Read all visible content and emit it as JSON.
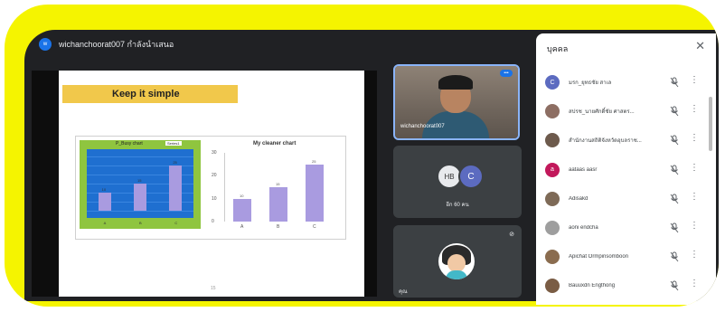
{
  "meeting": {
    "presenter_initial": "w",
    "presenter_title": "wichanchoorat007 กำลังนำเสนอ"
  },
  "slide": {
    "title": "Keep it simple",
    "page_num": "15"
  },
  "chart_data": [
    {
      "type": "bar",
      "title": "P_Busy chart",
      "legend": "Series1",
      "categories": [
        "A",
        "B",
        "C"
      ],
      "values": [
        10,
        15,
        25
      ],
      "ylim": [
        0,
        30
      ]
    },
    {
      "type": "bar",
      "title": "My cleaner chart",
      "categories": [
        "A",
        "B",
        "C"
      ],
      "values": [
        10,
        15,
        25
      ],
      "yticks": [
        "0",
        "10",
        "20",
        "30"
      ],
      "ylim": [
        0,
        30
      ]
    }
  ],
  "tiles": {
    "main_name": "wichanchoorat007",
    "group_initials": [
      "HB",
      "C"
    ],
    "group_caption": "อีก 60 คน",
    "user_caption": "คุณ"
  },
  "participants_panel": {
    "title": "บุคคล",
    "close_label": "✕",
    "participants": [
      {
        "name": "มรก_ยุทธชัย สาเล",
        "initial": "C",
        "color": "#5c6bc0"
      },
      {
        "name": "สปรช_นายศักดิ์ชัย ศาสตร...",
        "initial": "",
        "color": "#8d6e63"
      },
      {
        "name": "สำนักงานสถิติจังหวัดอุบลราช...",
        "initial": "",
        "color": "#6d5a4c"
      },
      {
        "name": "aataas aasr",
        "initial": "a",
        "color": "#c2185b"
      },
      {
        "name": "Adisakd",
        "initial": "",
        "color": "#7e6a57"
      },
      {
        "name": "aoni endcha",
        "initial": "",
        "color": "#9e9e9e"
      },
      {
        "name": "Apichat Ormpinsomboon",
        "initial": "",
        "color": "#8a6c4f"
      },
      {
        "name": "Bauuxdn Engthong",
        "initial": "",
        "color": "#7a5c44"
      }
    ]
  },
  "colors": {
    "frame": "#f5f400",
    "meet_bg": "#202124",
    "accent": "#1a73e8",
    "bar": "#a99be0"
  }
}
